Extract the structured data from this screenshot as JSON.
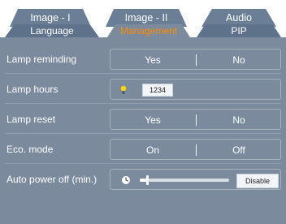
{
  "tabs": {
    "top": [
      {
        "label": "Image - I"
      },
      {
        "label": "Image - II"
      },
      {
        "label": "Audio"
      }
    ],
    "bottom": [
      {
        "label": "Language"
      },
      {
        "label": "Management",
        "active": true
      },
      {
        "label": "PIP"
      }
    ]
  },
  "menu": {
    "lamp_reminding": {
      "label": "Lamp reminding",
      "left": "Yes",
      "right": "No"
    },
    "lamp_hours": {
      "label": "Lamp hours",
      "value": "1234",
      "icon": "lamp-icon"
    },
    "lamp_reset": {
      "label": "Lamp  reset",
      "left": "Yes",
      "right": "No"
    },
    "eco_mode": {
      "label": "Eco. mode",
      "left": "On",
      "right": "Off"
    },
    "auto_power_off": {
      "label": "Auto power off (min.)",
      "button": "Disable",
      "icon": "clock-icon",
      "level_fraction": 0.08
    }
  },
  "colors": {
    "accent": "#ff8a00",
    "panel": "#7b8a9d",
    "tab": "#6a7e95"
  }
}
